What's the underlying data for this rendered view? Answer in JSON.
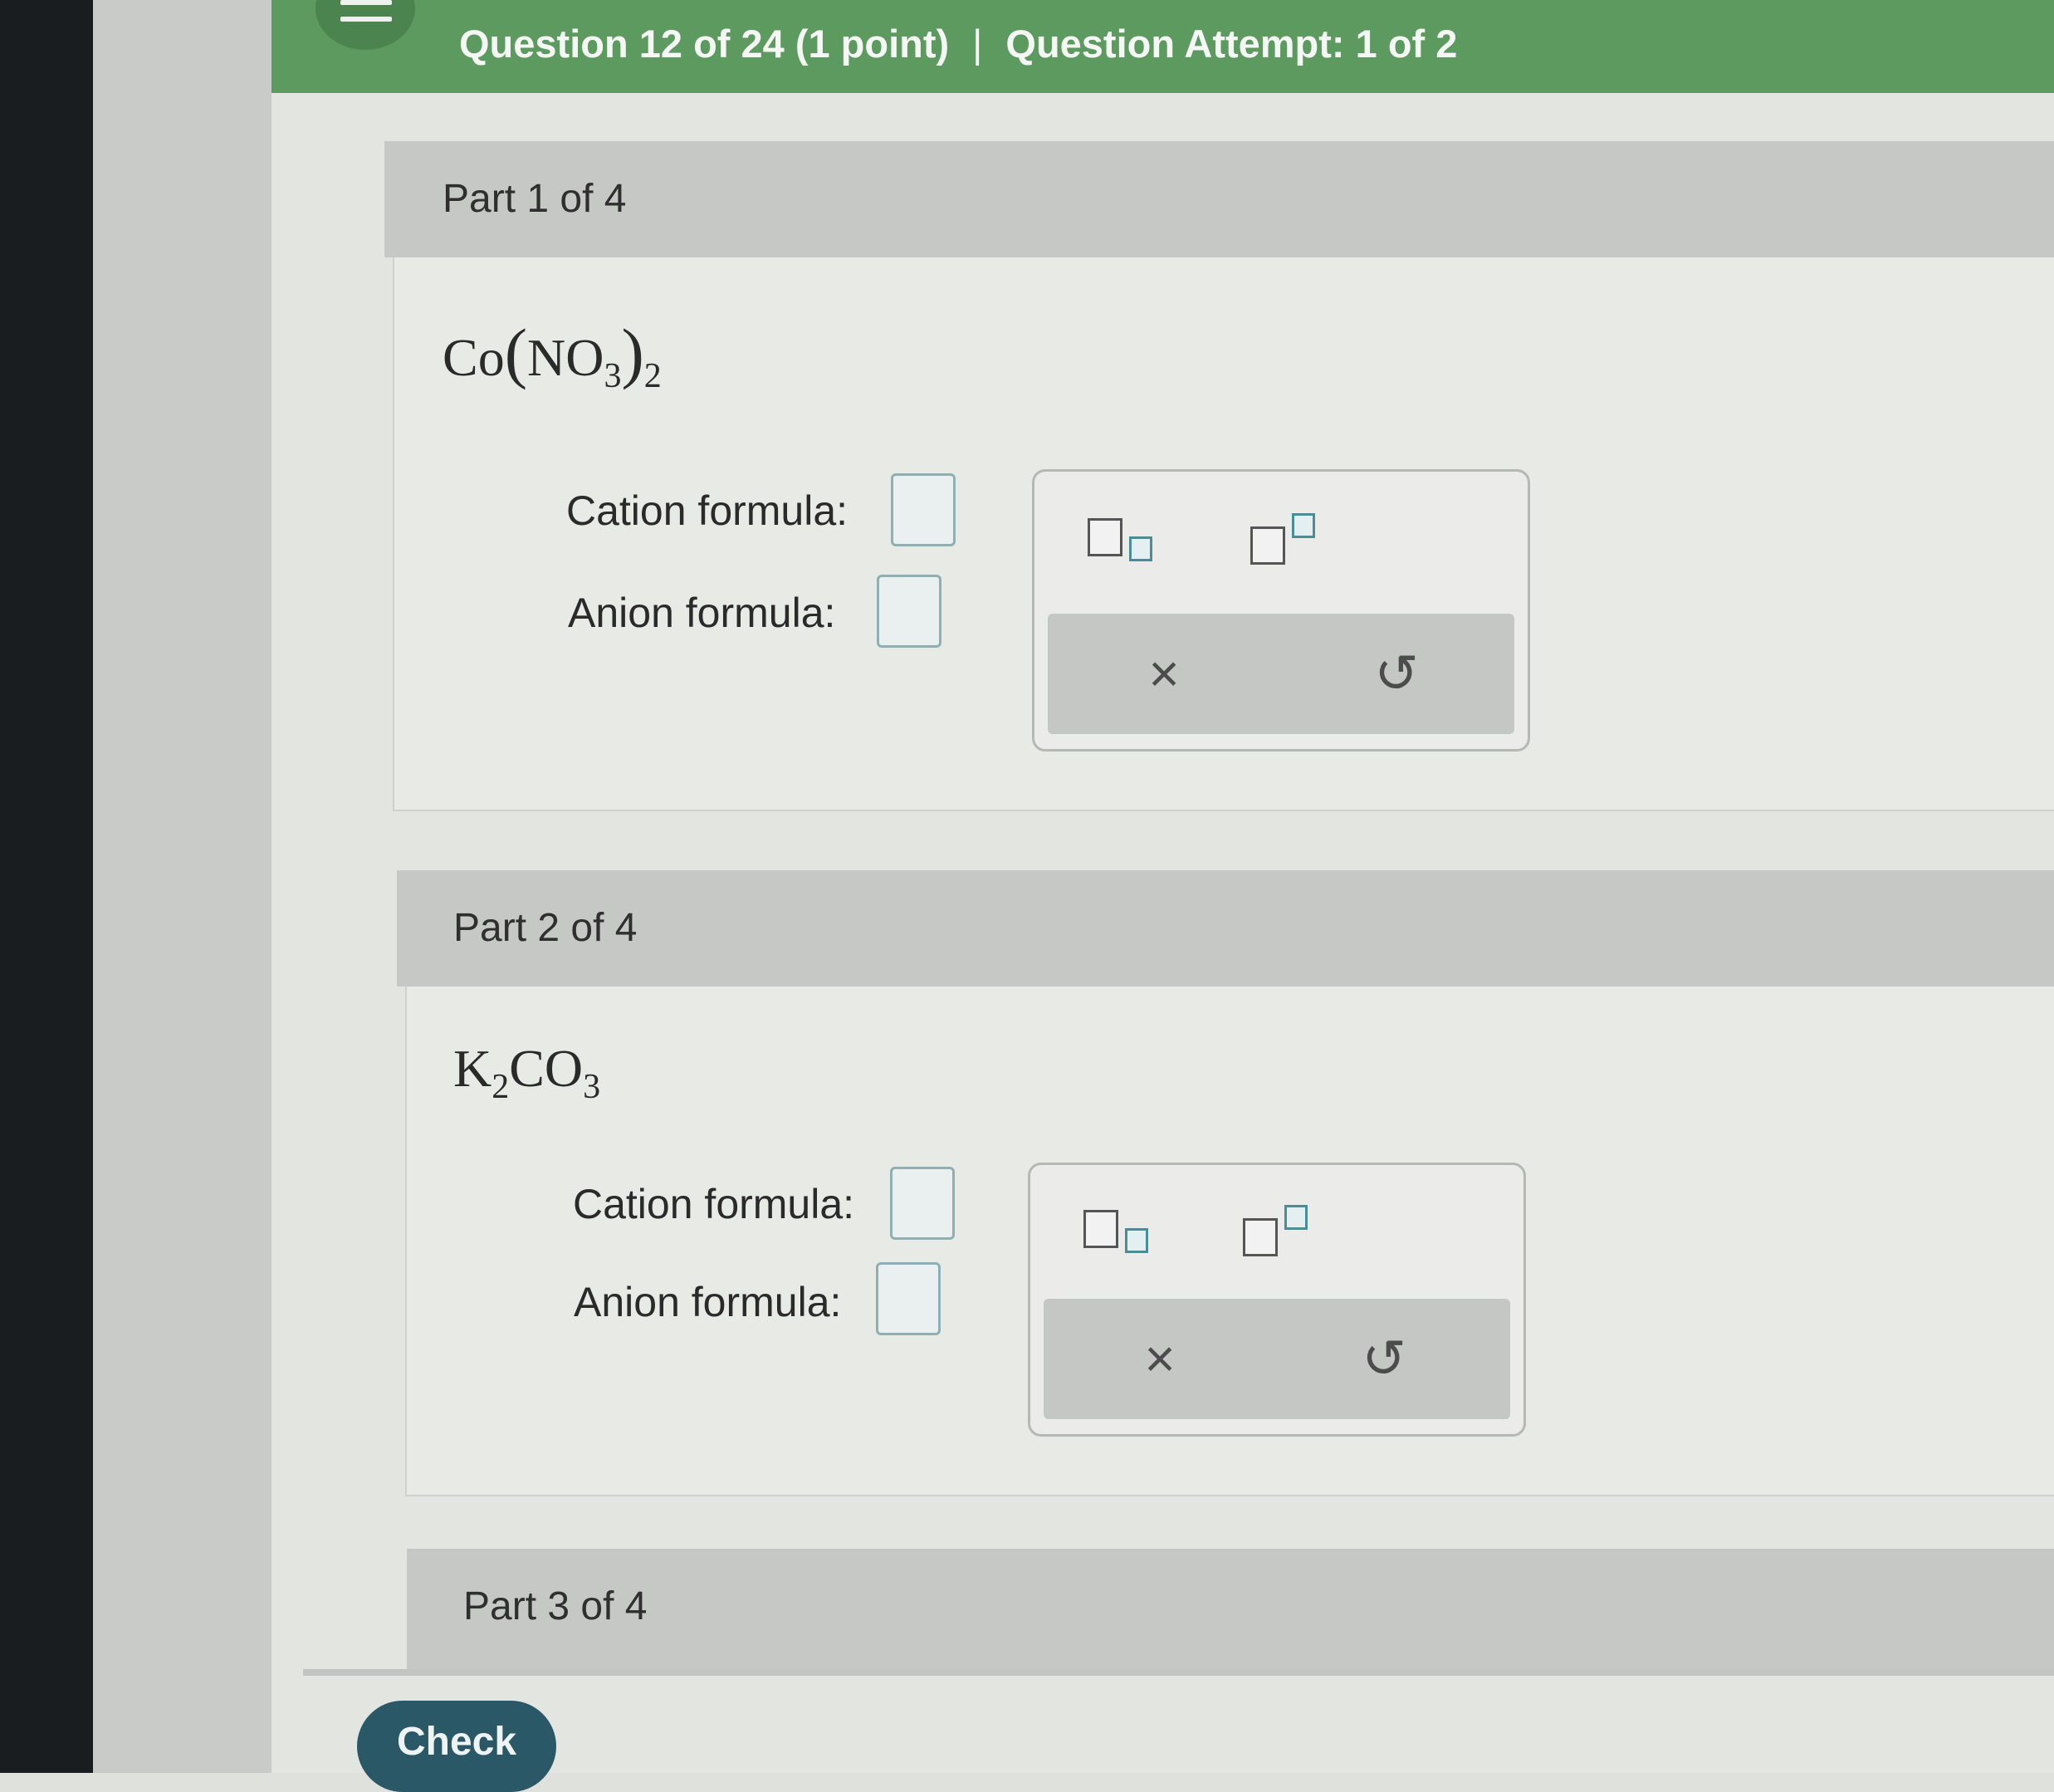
{
  "header": {
    "question": "Question 12 of 24 (1 point)",
    "separator": "|",
    "attempt": "Question Attempt: 1 of 2"
  },
  "parts": [
    {
      "title": "Part 1 of 4",
      "formula": {
        "a": "Co",
        "open": "(",
        "b": "NO",
        "sub1": "3",
        "close": ")",
        "sub2": "2"
      },
      "cation_label": "Cation formula:",
      "anion_label": "Anion formula:",
      "cation_value": "",
      "anion_value": ""
    },
    {
      "title": "Part 2 of 4",
      "formula": {
        "a": "K",
        "sub1": "2",
        "b": "CO",
        "sub2": "3"
      },
      "cation_label": "Cation formula:",
      "anion_label": "Anion formula:",
      "cation_value": "",
      "anion_value": ""
    },
    {
      "title": "Part 3 of 4"
    }
  ],
  "palette": {
    "subscript_icon": "subscript-icon",
    "superscript_icon": "superscript-icon",
    "clear_symbol": "×",
    "undo_symbol": "↺"
  },
  "footer": {
    "check_label": "Check"
  },
  "colors": {
    "header_green": "#5c9a5f",
    "check_button": "#2b5866",
    "input_border": "#8fb0b3"
  }
}
